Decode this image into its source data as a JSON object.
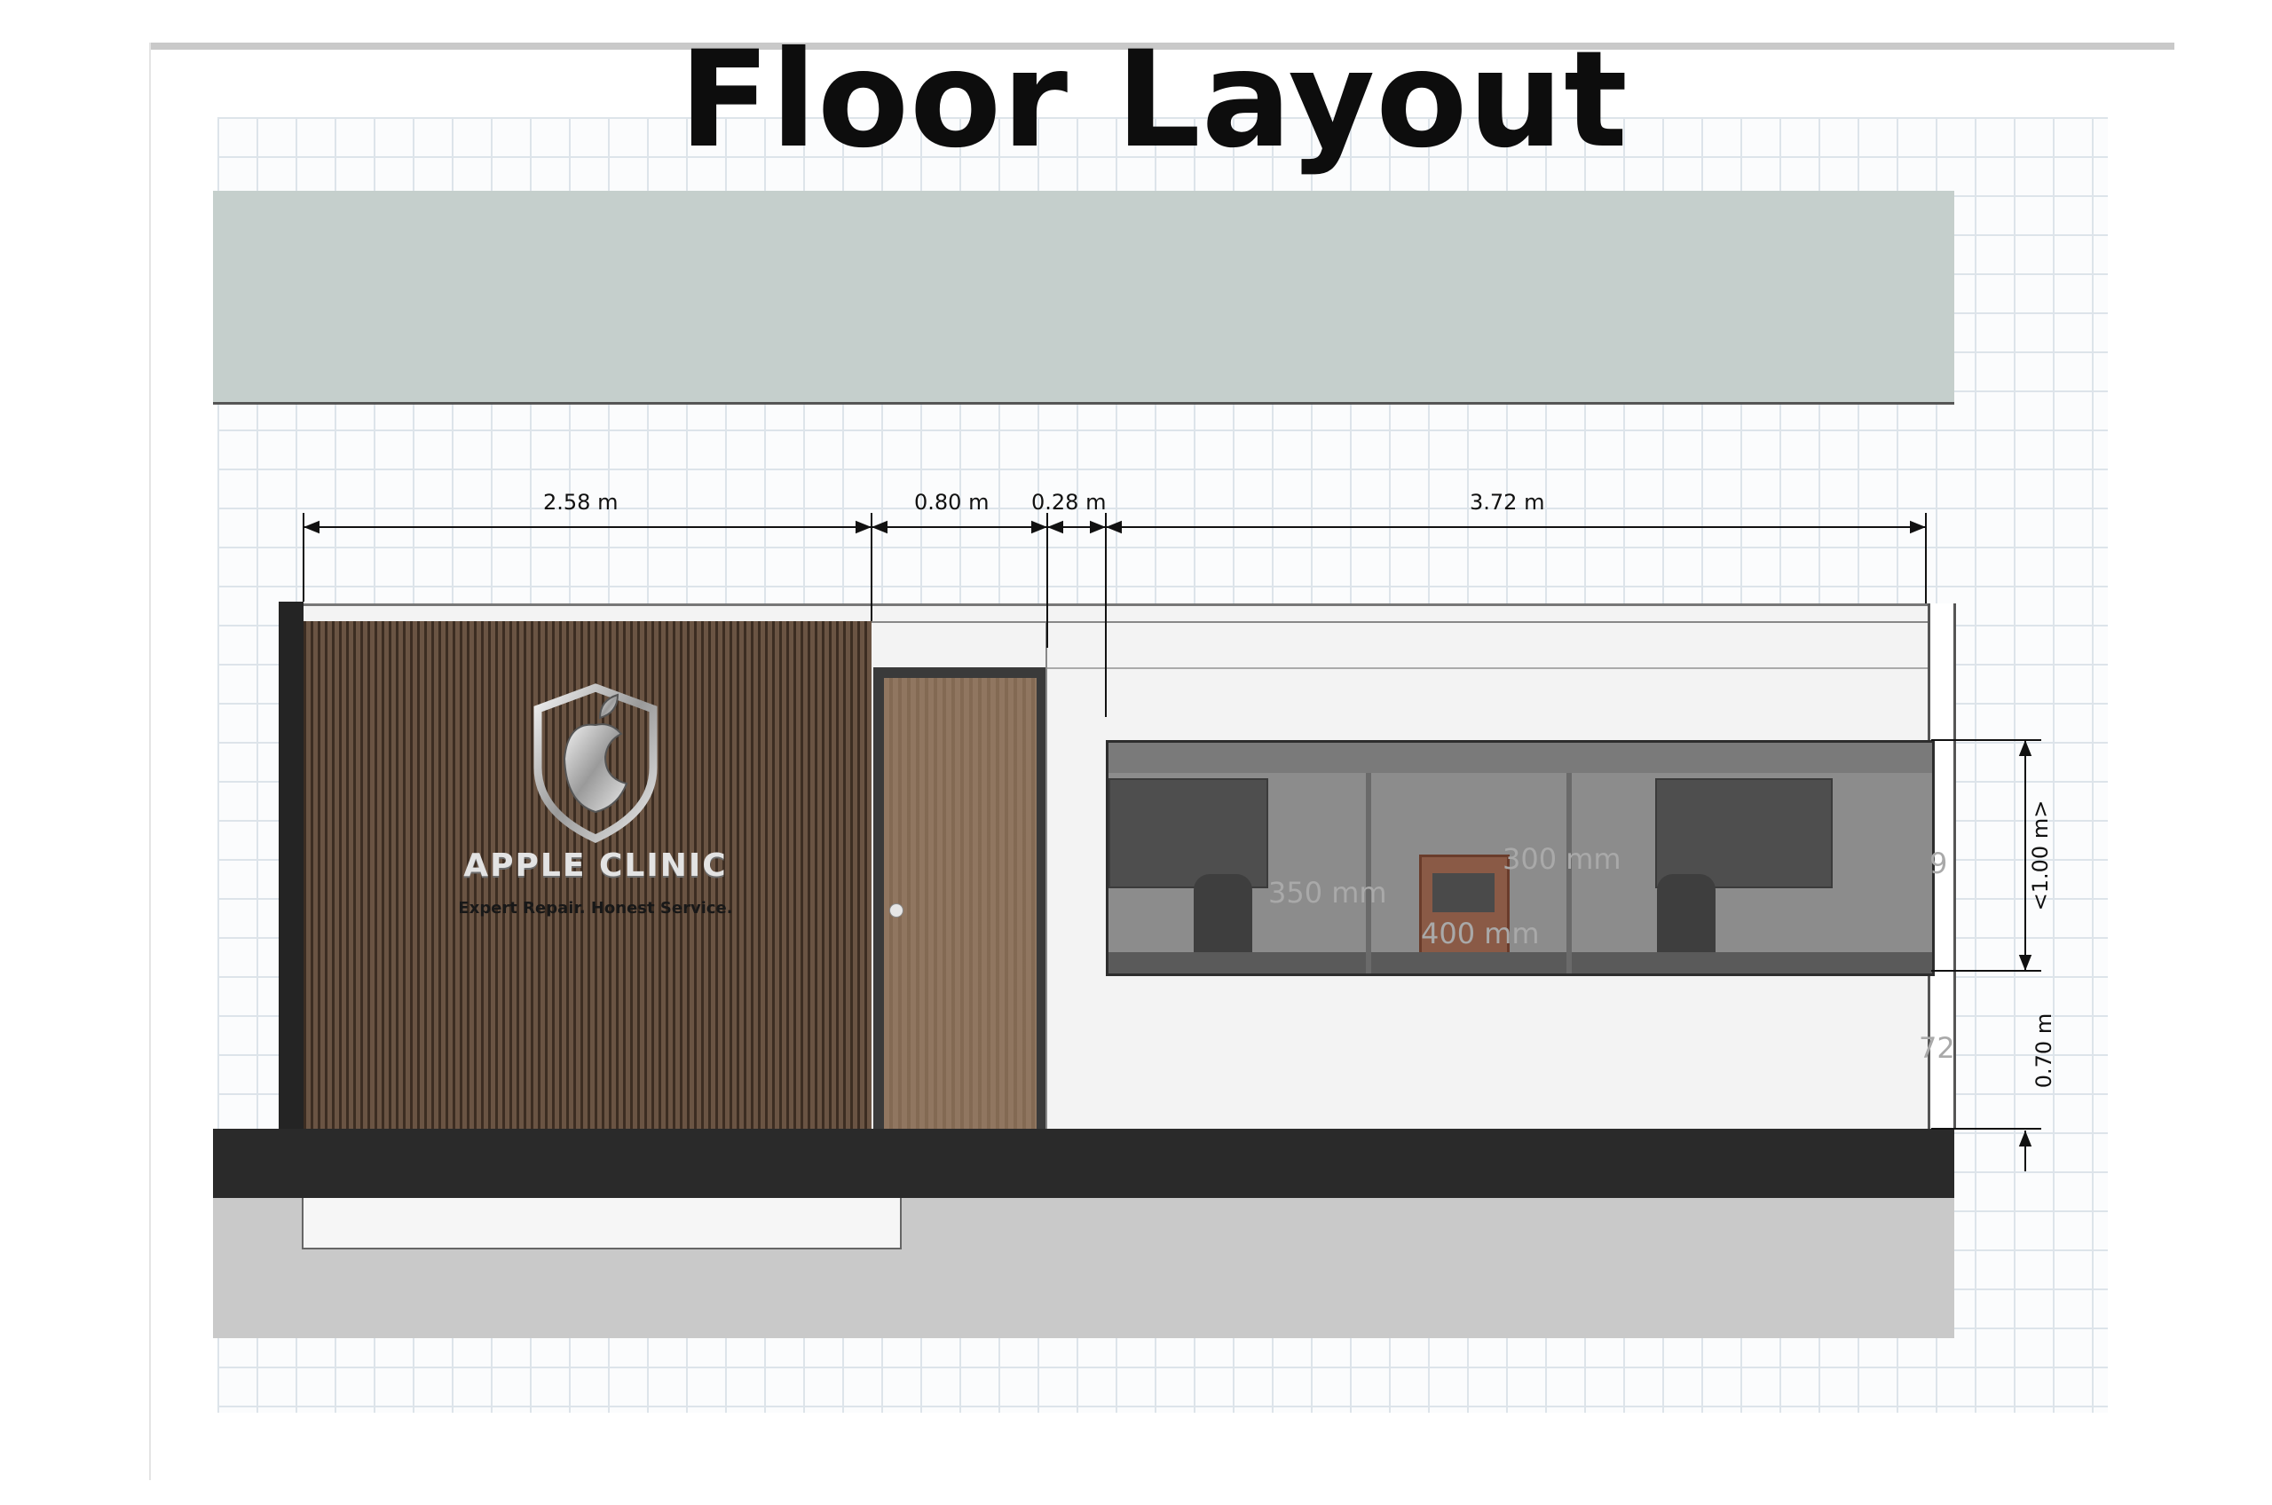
{
  "title": "Floor Layout",
  "brand": {
    "name": "APPLE CLINIC",
    "tagline": "Expert Repair. Honest Service."
  },
  "dimensions": {
    "horizontal": [
      "2.58 m",
      "0.80 m",
      "0.28 m",
      "3.72 m"
    ],
    "window_height": "<1.00 m>",
    "sill_height": "0.70 m"
  },
  "window_labels": [
    "300 mm",
    "350 mm",
    "400 mm",
    "9",
    "72"
  ],
  "icons": [
    "apple-shield-logo-icon",
    "door-knob-icon",
    "chair-icon",
    "console-icon"
  ],
  "colors": {
    "wood_panel": "#5b4636",
    "door": "#8a6f57",
    "slab": "#2a2a2a",
    "ceiling": "#c5cfcc"
  }
}
